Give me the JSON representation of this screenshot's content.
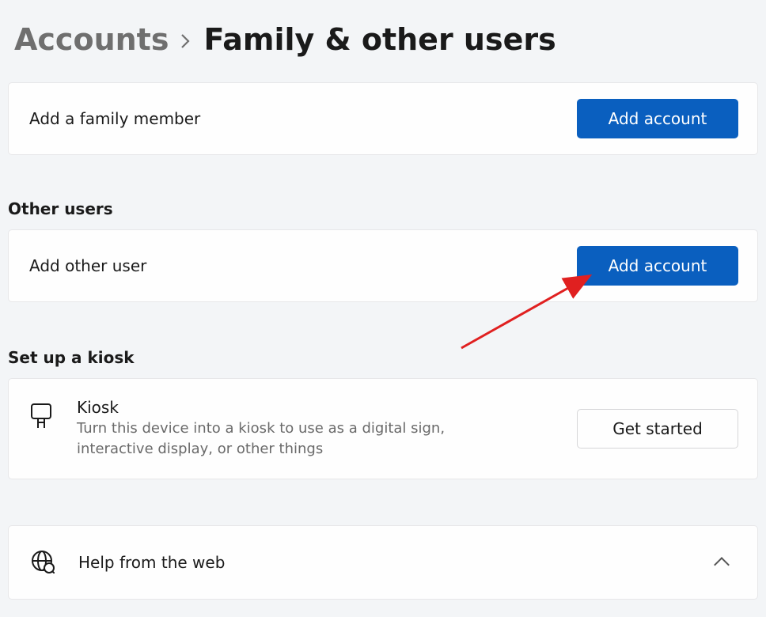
{
  "breadcrumb": {
    "parent": "Accounts",
    "current": "Family & other users"
  },
  "family": {
    "add_label": "Add a family member",
    "add_button": "Add account"
  },
  "other_users": {
    "header": "Other users",
    "add_label": "Add other user",
    "add_button": "Add account"
  },
  "kiosk": {
    "header": "Set up a kiosk",
    "title": "Kiosk",
    "description": "Turn this device into a kiosk to use as a digital sign, interactive display, or other things",
    "button": "Get started"
  },
  "help": {
    "label": "Help from the web"
  }
}
